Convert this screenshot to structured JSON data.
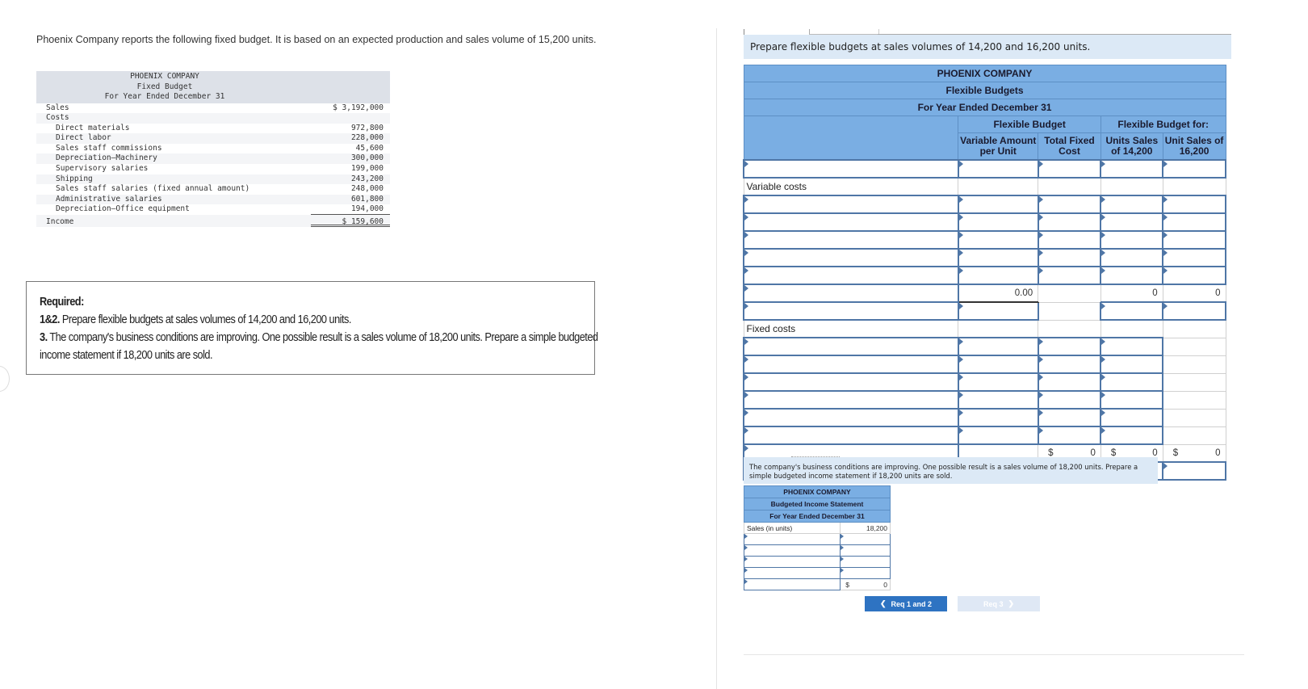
{
  "intro_text": "Phoenix Company reports the following fixed budget. It is based on an expected production and sales volume of 15,200 units.",
  "fixed_budget": {
    "company": "PHOENIX COMPANY",
    "title": "Fixed Budget",
    "period": "For Year Ended December 31",
    "rows": [
      {
        "label": "Sales",
        "value": "$ 3,192,000",
        "level": 0
      },
      {
        "label": "Costs",
        "value": "",
        "level": 0
      },
      {
        "label": "Direct materials",
        "value": "972,800",
        "level": 1
      },
      {
        "label": "Direct labor",
        "value": "228,000",
        "level": 1
      },
      {
        "label": "Sales staff commissions",
        "value": "45,600",
        "level": 1
      },
      {
        "label": "Depreciation—Machinery",
        "value": "300,000",
        "level": 1
      },
      {
        "label": "Supervisory salaries",
        "value": "199,000",
        "level": 1
      },
      {
        "label": "Shipping",
        "value": "243,200",
        "level": 1
      },
      {
        "label": "Sales staff salaries (fixed annual amount)",
        "value": "248,000",
        "level": 1
      },
      {
        "label": "Administrative salaries",
        "value": "601,800",
        "level": 1
      },
      {
        "label": "Depreciation—Office equipment",
        "value": "194,000",
        "level": 1
      },
      {
        "label": "Income",
        "value": "$ 159,600",
        "level": 0
      }
    ]
  },
  "required": {
    "heading": "Required:",
    "item1_num": "1&2.",
    "item1_text": " Prepare flexible budgets at sales volumes of 14,200 and 16,200 units.",
    "item3_num": "3.",
    "item3_text": " The company's business conditions are improving. One possible result is a sales volume of 18,200 units. Prepare a simple budgeted income statement if 18,200 units are sold."
  },
  "req12": {
    "instruction": "Prepare flexible budgets at sales volumes of 14,200 and 16,200 units.",
    "company": "PHOENIX COMPANY",
    "title": "Flexible Budgets",
    "period": "For Year Ended December 31",
    "group1": "Flexible Budget",
    "group2": "Flexible Budget for:",
    "col_variable": "Variable Amount per Unit",
    "col_fixed": "Total Fixed Cost",
    "col_14200": "Units Sales of 14,200",
    "col_16200": "Unit Sales of 16,200",
    "variable_costs_label": "Variable costs",
    "fixed_costs_label": "Fixed costs",
    "variable_total": {
      "per_unit": "0.00",
      "u14200": "0",
      "u16200": "0"
    },
    "fixed_total": {
      "currency": "$",
      "fixed": "0",
      "u14200": "0",
      "u16200": "0"
    }
  },
  "req3": {
    "instruction": "The company's business conditions are improving. One possible result is a sales volume of 18,200 units. Prepare a simple budgeted income statement if 18,200 units are sold.",
    "company": "PHOENIX COMPANY",
    "title": "Budgeted Income Statement",
    "period": "For Year Ended December 31",
    "sales_units_label": "Sales (in units)",
    "sales_units_value": "18,200",
    "total_currency": "$",
    "total_value": "0"
  },
  "nav": {
    "prev_label": "Req 1 and 2",
    "next_label": "Req 3",
    "prev_icon": "chevron-left-icon",
    "next_icon": "chevron-right-icon"
  }
}
